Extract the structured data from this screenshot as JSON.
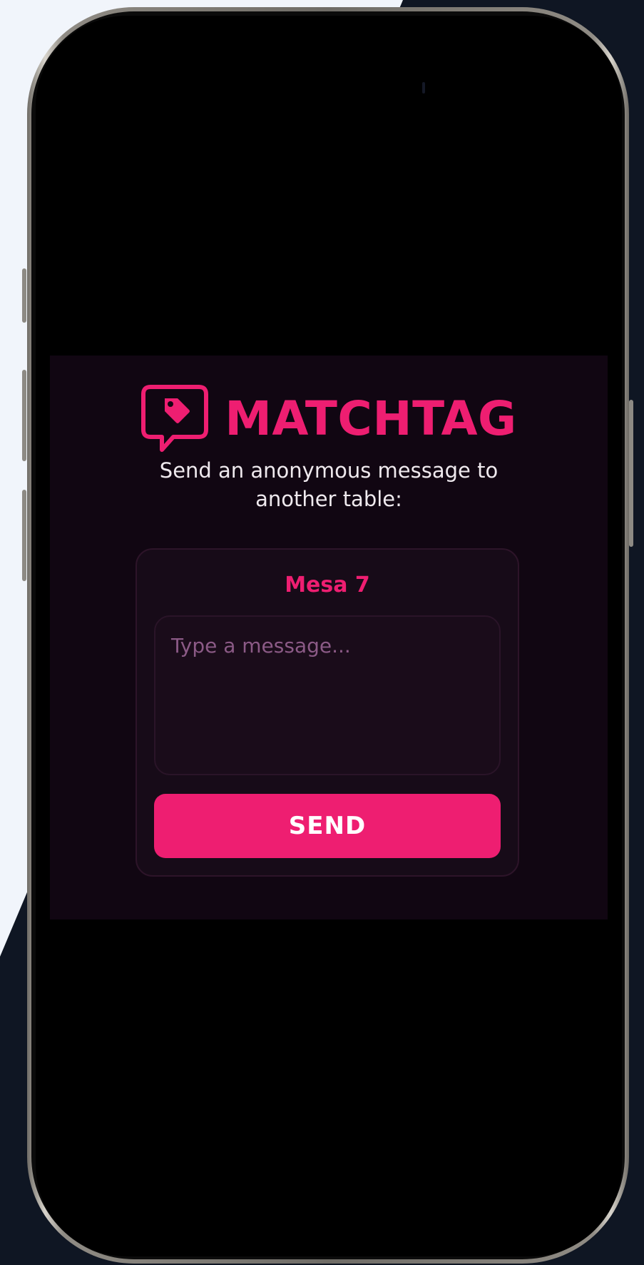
{
  "app": {
    "brand_name": "MATCHTAG",
    "subtitle": "Send an anonymous message to another table:",
    "accent_color": "#ee1e71",
    "logo_icon": "chat-bubble-tag-icon"
  },
  "message_card": {
    "table_name": "Mesa 7",
    "message_input": {
      "value": "",
      "placeholder": "Type a message..."
    },
    "send_label": "SEND"
  }
}
